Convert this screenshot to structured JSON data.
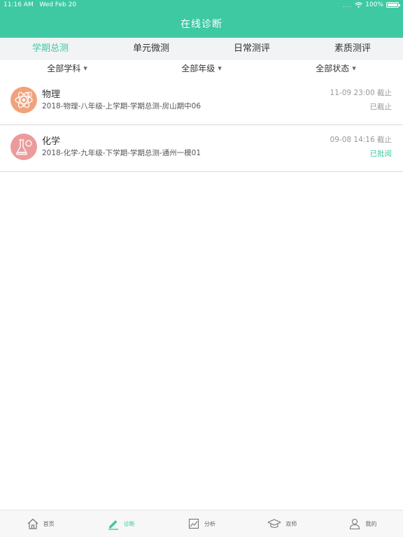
{
  "status_bar": {
    "time": "11:16 AM",
    "date": "Wed Feb 20",
    "signal": "....",
    "battery": "100%"
  },
  "header": {
    "title": "在线诊断"
  },
  "tabs": [
    {
      "label": "学期总测",
      "active": true
    },
    {
      "label": "单元微测",
      "active": false
    },
    {
      "label": "日常测评",
      "active": false
    },
    {
      "label": "素质测评",
      "active": false
    }
  ],
  "filters": [
    {
      "label": "全部学科"
    },
    {
      "label": "全部年级"
    },
    {
      "label": "全部状态"
    }
  ],
  "items": [
    {
      "subject": "物理",
      "icon": "atom-icon",
      "exam": "2018-物理-八年级-上学期-学期总测-房山期中06",
      "deadline": "11-09 23:00 截止",
      "status": "已截止",
      "status_color": "#999999"
    },
    {
      "subject": "化学",
      "icon": "flask-icon",
      "exam": "2018-化学-九年级-下学期-学期总测-通州一模01",
      "deadline": "09-08 14:16 截止",
      "status": "已批阅",
      "status_color": "#3ec9a3"
    }
  ],
  "nav": [
    {
      "label": "首页",
      "icon": "home-icon",
      "active": false
    },
    {
      "label": "诊断",
      "icon": "pencil-icon",
      "active": true
    },
    {
      "label": "分析",
      "icon": "chart-icon",
      "active": false
    },
    {
      "label": "双师",
      "icon": "graduation-cap-icon",
      "active": false
    },
    {
      "label": "我的",
      "icon": "user-icon",
      "active": false
    }
  ],
  "colors": {
    "accent": "#3ec9a3",
    "physics": "#f2a27b",
    "chemistry": "#ec9b9b"
  }
}
